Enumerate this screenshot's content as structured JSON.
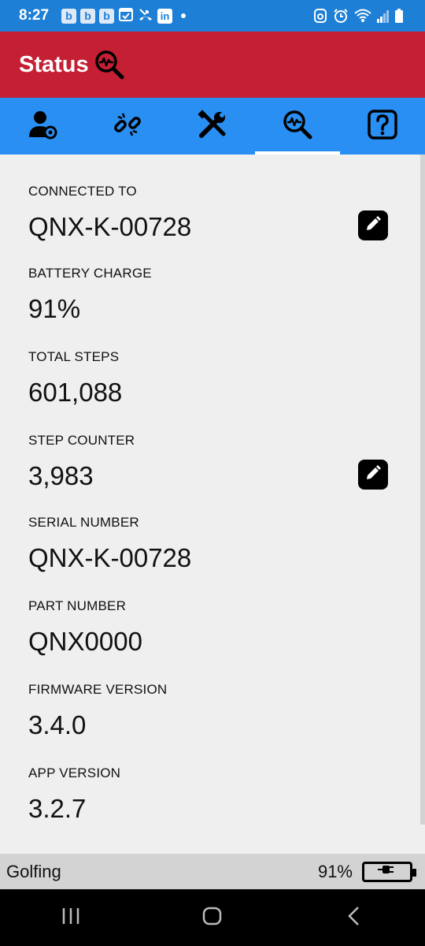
{
  "status_bar": {
    "time": "8:27",
    "notifications": [
      "b",
      "b",
      "b"
    ],
    "linkedin": "in"
  },
  "app_bar": {
    "title": "Status",
    "icon": "status-search-icon"
  },
  "tabs": [
    {
      "name": "user-settings-icon",
      "active": false
    },
    {
      "name": "broken-link-icon",
      "active": false
    },
    {
      "name": "tools-icon",
      "active": false
    },
    {
      "name": "status-search-icon",
      "active": true
    },
    {
      "name": "help-icon",
      "active": false
    }
  ],
  "fields": [
    {
      "label": "CONNECTED TO",
      "value": "QNX-K-00728",
      "editable": true
    },
    {
      "label": "BATTERY CHARGE",
      "value": "91%",
      "editable": false
    },
    {
      "label": "TOTAL STEPS",
      "value": "601,088",
      "editable": false
    },
    {
      "label": "STEP COUNTER",
      "value": "3,983",
      "editable": true
    },
    {
      "label": "SERIAL NUMBER",
      "value": "QNX-K-00728",
      "editable": false
    },
    {
      "label": "PART NUMBER",
      "value": "QNX0000",
      "editable": false
    },
    {
      "label": "FIRMWARE VERSION",
      "value": "3.4.0",
      "editable": false
    },
    {
      "label": "APP VERSION",
      "value": "3.2.7",
      "editable": false
    }
  ],
  "bottom_status": {
    "mode": "Golfing",
    "battery_pct": "91%",
    "charging": true
  },
  "colors": {
    "status_bar": "#1e7fd6",
    "app_bar": "#c51f33",
    "tabs": "#2a8ff3",
    "background": "#efefef",
    "bottom_status": "#d3d3d3"
  }
}
